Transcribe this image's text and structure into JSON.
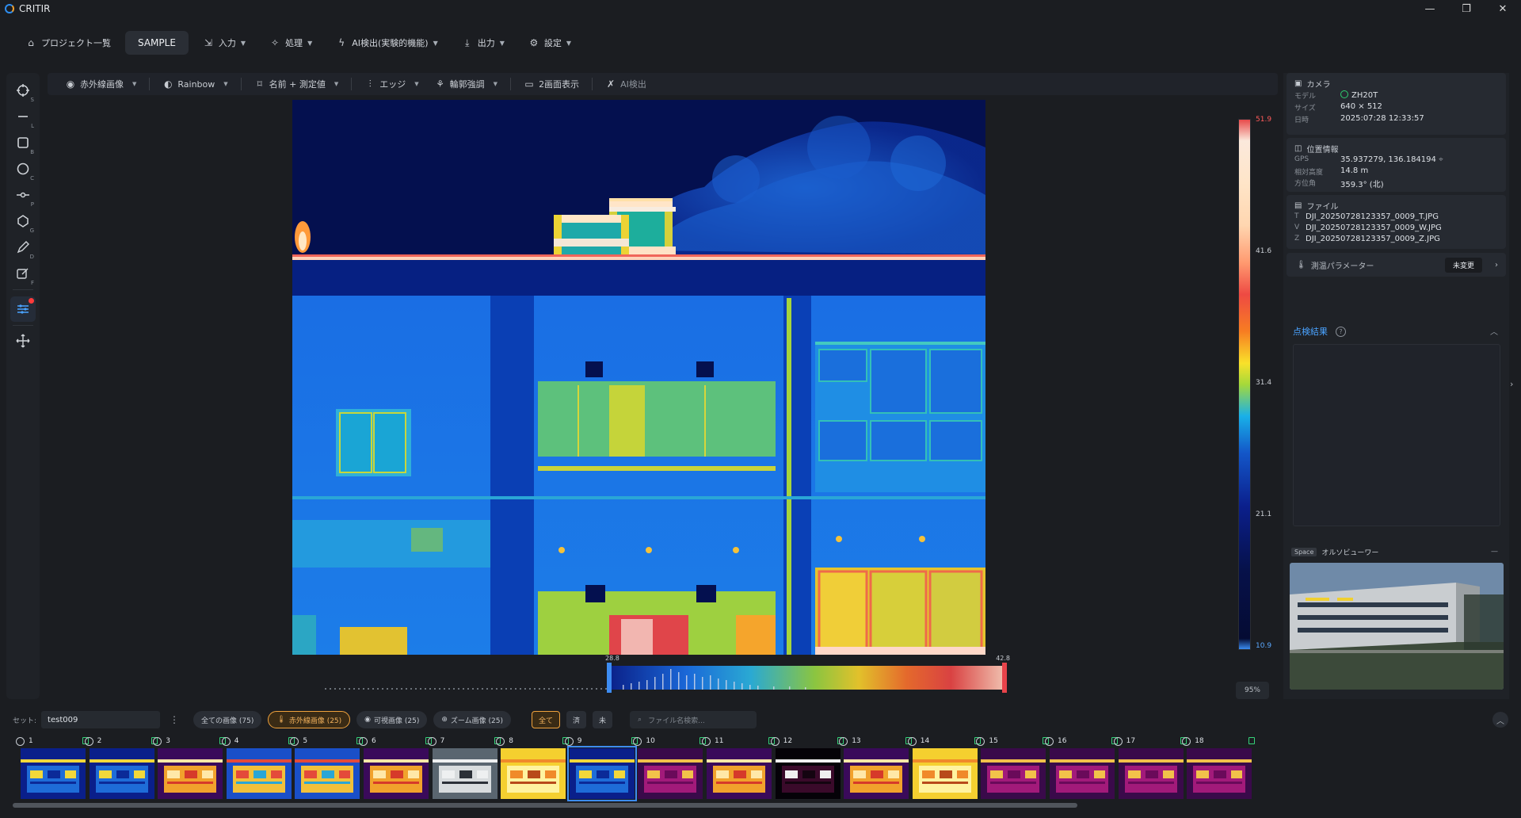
{
  "app": {
    "title": "CRITIR",
    "window_controls": [
      "minimize-icon",
      "restore-icon",
      "close-icon"
    ]
  },
  "menu": {
    "project": "プロジェクト一覧",
    "sample": "SAMPLE",
    "input": "入力",
    "process": "処理",
    "ai": "AI検出(実験的機能)",
    "output": "出力",
    "settings": "設定"
  },
  "tools": [
    {
      "icon": "target-icon",
      "key": "S"
    },
    {
      "icon": "line-icon",
      "key": "L"
    },
    {
      "icon": "rectangle-icon",
      "key": "B"
    },
    {
      "icon": "circle-icon",
      "key": "C"
    },
    {
      "icon": "point-icon",
      "key": "P"
    },
    {
      "icon": "polygon-icon",
      "key": "G"
    },
    {
      "icon": "pen-icon",
      "key": "D"
    },
    {
      "icon": "edit-icon",
      "key": "F"
    },
    {
      "icon": "sliders-icon",
      "key": ""
    },
    {
      "icon": "move-icon",
      "key": ""
    }
  ],
  "viewer_toolbar": {
    "ir_image": "赤外線画像",
    "palette": "Rainbow",
    "label_mode": "名前 + 測定値",
    "edge": "エッジ",
    "contour": "輪郭強調",
    "dual_view": "2画面表示",
    "ai_detect": "AI検出"
  },
  "scale": {
    "max": "51.9",
    "t1": "41.6",
    "t2": "31.4",
    "t3": "21.1",
    "min": "10.9"
  },
  "histogram": {
    "low": "28.8",
    "high": "42.8"
  },
  "zoom": "95%",
  "camera": {
    "title": "カメラ",
    "model_label": "モデル",
    "model": "ZH20T",
    "size_label": "サイズ",
    "size": "640 × 512",
    "date_label": "日時",
    "date": "2025:07:28 12:33:57"
  },
  "location": {
    "title": "位置情報",
    "gps_label": "GPS",
    "gps": "35.937279, 136.184194",
    "alt_label": "相対高度",
    "alt": "14.8 m",
    "heading_label": "方位角",
    "heading": "359.3° (北)"
  },
  "files": {
    "title": "ファイル",
    "t_label": "T",
    "t": "DJI_20250728123357_0009_T.JPG",
    "v_label": "V",
    "v": "DJI_20250728123357_0009_W.JPG",
    "z_label": "Z",
    "z": "DJI_20250728123357_0009_Z.JPG"
  },
  "params": {
    "label": "測温パラメーター",
    "status": "未変更"
  },
  "results": {
    "title": "点検結果"
  },
  "ortho": {
    "tag": "Space",
    "title": "オルソビューワー"
  },
  "filterbar": {
    "set_label": "セット:",
    "set_value": "test009",
    "all_images": "全ての画像 (75)",
    "ir_images": "赤外線画像 (25)",
    "visible_images": "可視画像 (25)",
    "zoom_images": "ズーム画像 (25)",
    "all": "全て",
    "done": "済",
    "todo": "未",
    "search_placeholder": "ファイル名検索..."
  },
  "thumbnails": [
    {
      "n": "1",
      "palette": "blue"
    },
    {
      "n": "2",
      "palette": "blue"
    },
    {
      "n": "3",
      "palette": "iron"
    },
    {
      "n": "4",
      "palette": "rainbow"
    },
    {
      "n": "5",
      "palette": "rainbow"
    },
    {
      "n": "6",
      "palette": "iron"
    },
    {
      "n": "7",
      "palette": "visible"
    },
    {
      "n": "8",
      "palette": "yellow"
    },
    {
      "n": "9",
      "palette": "blue",
      "selected": true
    },
    {
      "n": "10",
      "palette": "magenta"
    },
    {
      "n": "11",
      "palette": "iron"
    },
    {
      "n": "12",
      "palette": "dark"
    },
    {
      "n": "13",
      "palette": "iron"
    },
    {
      "n": "14",
      "palette": "yellow"
    },
    {
      "n": "15",
      "palette": "magenta"
    },
    {
      "n": "16",
      "palette": "magenta"
    },
    {
      "n": "17",
      "palette": "magenta"
    },
    {
      "n": "18",
      "palette": "magenta"
    }
  ]
}
